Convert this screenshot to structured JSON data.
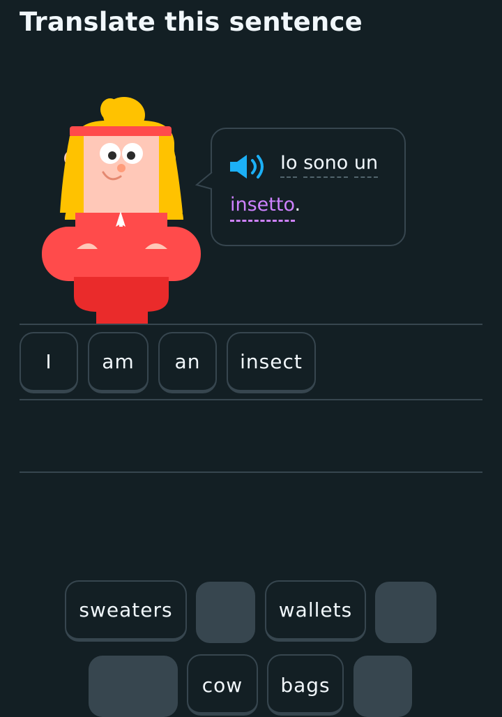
{
  "header": {
    "title": "Translate this sentence"
  },
  "prompt": {
    "speaker_icon": "speaker-icon",
    "words": [
      "Io",
      "sono",
      "un"
    ],
    "highlighted_word": "insetto",
    "punctuation": "."
  },
  "answer_area": {
    "tiles": [
      {
        "label": "I"
      },
      {
        "label": "am"
      },
      {
        "label": "an"
      },
      {
        "label": "insect"
      }
    ]
  },
  "word_bank": {
    "tiles": [
      {
        "label": "sweaters",
        "used": false
      },
      {
        "label": "",
        "used": true
      },
      {
        "label": "wallets",
        "used": false
      },
      {
        "label": "",
        "used": true
      },
      {
        "label": "",
        "used": true
      },
      {
        "label": "cow",
        "used": false
      },
      {
        "label": "bags",
        "used": false
      },
      {
        "label": "",
        "used": true
      }
    ]
  },
  "colors": {
    "background": "#131f24",
    "border": "#37464f",
    "highlight": "#ce82ff",
    "speaker": "#1cb0f6",
    "text": "#f1f7fb"
  }
}
